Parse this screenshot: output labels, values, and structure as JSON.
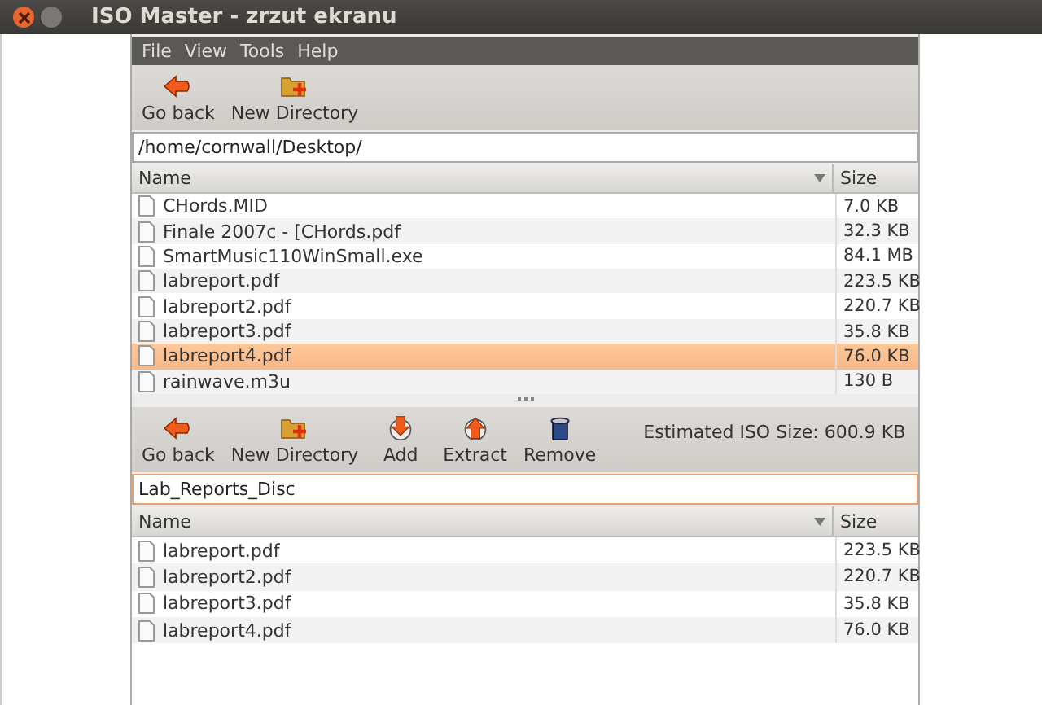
{
  "window": {
    "title": "ISO Master - zrzut ekranu"
  },
  "menu": [
    "File",
    "View",
    "Tools",
    "Help"
  ],
  "top_toolbar": [
    {
      "kind": "back",
      "label": "Go back"
    },
    {
      "kind": "newdir",
      "label": "New Directory"
    }
  ],
  "top_path": {
    "value": "/home/cornwall/Desktop/"
  },
  "top_table": {
    "columns": [
      "Name",
      "Size"
    ],
    "rows": [
      {
        "name": "CHords.MID",
        "size": "7.0 KB",
        "selected": false
      },
      {
        "name": "Finale 2007c - [CHords.pdf",
        "size": "32.3 KB",
        "selected": false
      },
      {
        "name": "SmartMusic110WinSmall.exe",
        "size": "84.1 MB",
        "selected": false
      },
      {
        "name": "labreport.pdf",
        "size": "223.5 KB",
        "selected": false
      },
      {
        "name": "labreport2.pdf",
        "size": "220.7 KB",
        "selected": false
      },
      {
        "name": "labreport3.pdf",
        "size": "35.8 KB",
        "selected": false
      },
      {
        "name": "labreport4.pdf",
        "size": "76.0 KB",
        "selected": true
      },
      {
        "name": "rainwave.m3u",
        "size": "130 B",
        "selected": false
      }
    ]
  },
  "bottom_toolbar": [
    {
      "kind": "back",
      "label": "Go back"
    },
    {
      "kind": "newdir",
      "label": "New Directory"
    },
    {
      "kind": "add",
      "label": "Add"
    },
    {
      "kind": "extract",
      "label": "Extract"
    },
    {
      "kind": "remove",
      "label": "Remove"
    }
  ],
  "iso_size": "Estimated ISO Size: 600.9 KB",
  "bottom_path": {
    "value": "Lab_Reports_Disc"
  },
  "bottom_table": {
    "columns": [
      "Name",
      "Size"
    ],
    "rows": [
      {
        "name": "labreport.pdf",
        "size": "223.5 KB",
        "selected": false
      },
      {
        "name": "labreport2.pdf",
        "size": "220.7 KB",
        "selected": false
      },
      {
        "name": "labreport3.pdf",
        "size": "35.8 KB",
        "selected": false
      },
      {
        "name": "labreport4.pdf",
        "size": "76.0 KB",
        "selected": false
      }
    ]
  }
}
